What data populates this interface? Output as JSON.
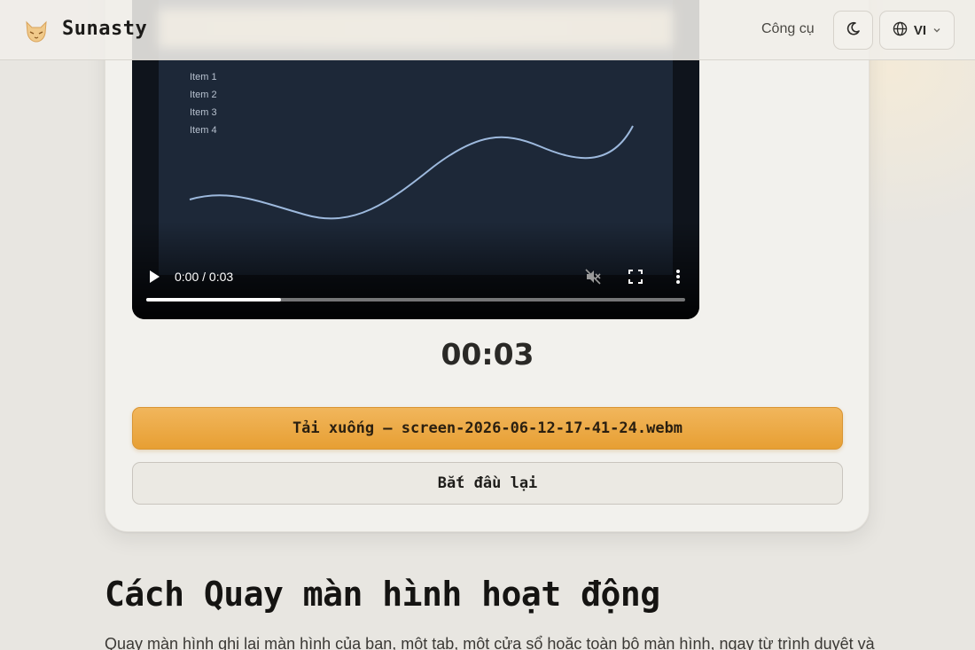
{
  "header": {
    "brand": "Sunasty",
    "nav_tools": "Công cụ",
    "language": "VI",
    "icons": {
      "logo": "fox-logo-icon",
      "theme": "moon-icon",
      "language": "globe-icon",
      "chevron": "chevron-down-icon"
    }
  },
  "video": {
    "legend": [
      "Item 1",
      "Item 2",
      "Item 3",
      "Item 4"
    ],
    "time_label": "0:00 / 0:03",
    "progress": 0.25,
    "icons": {
      "play": "play-icon",
      "mute": "muted-speaker-icon",
      "fullscreen": "fullscreen-icon",
      "more": "more-vertical-icon"
    }
  },
  "timer": "00:03",
  "actions": {
    "download_label": "Tải xuống — screen-2026-06-12-17-41-24.webm",
    "restart_label": "Bắt đầu lại"
  },
  "section": {
    "title": "Cách Quay màn hình hoạt động",
    "text": "Quay màn hình ghi lại màn hình của bạn, một tab, một cửa sổ hoặc toàn bộ màn hình, ngay từ trình duyệt và"
  },
  "colors": {
    "accent": "#e9a43f",
    "background": "#e8e6e1",
    "card": "#f2f1ed"
  }
}
